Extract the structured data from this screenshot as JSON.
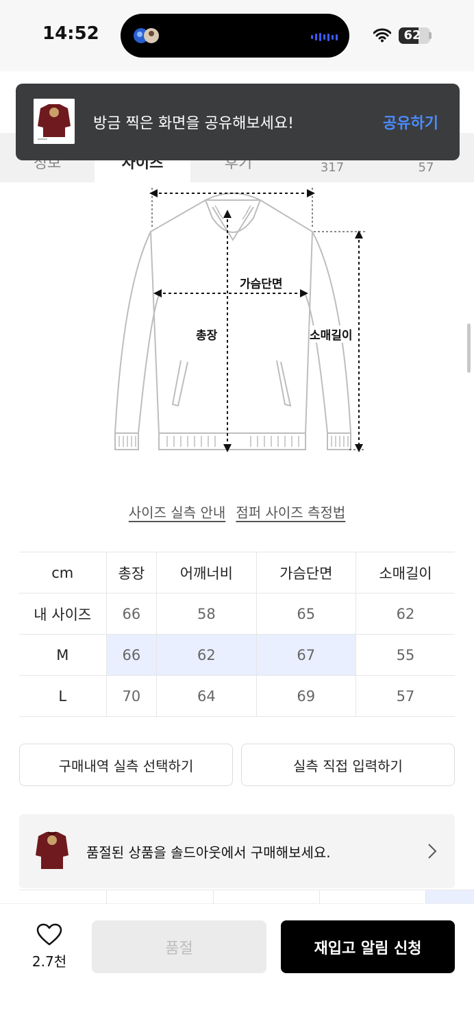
{
  "status_bar": {
    "time": "14:52",
    "battery": "62",
    "battery_level": 0.62
  },
  "toast": {
    "message": "방금 찍은 화면을 공유해보세요!",
    "action": "공유하기"
  },
  "tabs": [
    {
      "label": "정보",
      "count": ""
    },
    {
      "label": "사이즈",
      "count": ""
    },
    {
      "label": "후기",
      "count": "317"
    },
    {
      "label": "",
      "count": "57"
    }
  ],
  "diagram": {
    "chest": "가슴단면",
    "length": "총장",
    "sleeve": "소매길이"
  },
  "links": {
    "size_guide": "사이즈 실측 안내",
    "measure_method": "점퍼 사이즈 측정법"
  },
  "size_table": {
    "headers": [
      "cm",
      "총장",
      "어깨너비",
      "가슴단면",
      "소매길이"
    ],
    "rows": [
      {
        "label": "내 사이즈",
        "values": [
          "66",
          "58",
          "65",
          "62"
        ]
      },
      {
        "label": "M",
        "values": [
          "66",
          "62",
          "67",
          "55"
        ]
      },
      {
        "label": "L",
        "values": [
          "70",
          "64",
          "69",
          "57"
        ]
      }
    ]
  },
  "buttons": {
    "purchase_history": "구매내역 실측 선택하기",
    "manual_input": "실측 직접 입력하기"
  },
  "soldout_banner": {
    "text": "품절된 상품을 솔드아웃에서 구매해보세요."
  },
  "bottom_bar": {
    "wish_count": "2.7천",
    "soldout_label": "품절",
    "restock_label": "재입고 알림 신청"
  },
  "colors": {
    "accent": "#4a8cff",
    "highlight": "#e9efff",
    "product": "#6e1a1e"
  }
}
